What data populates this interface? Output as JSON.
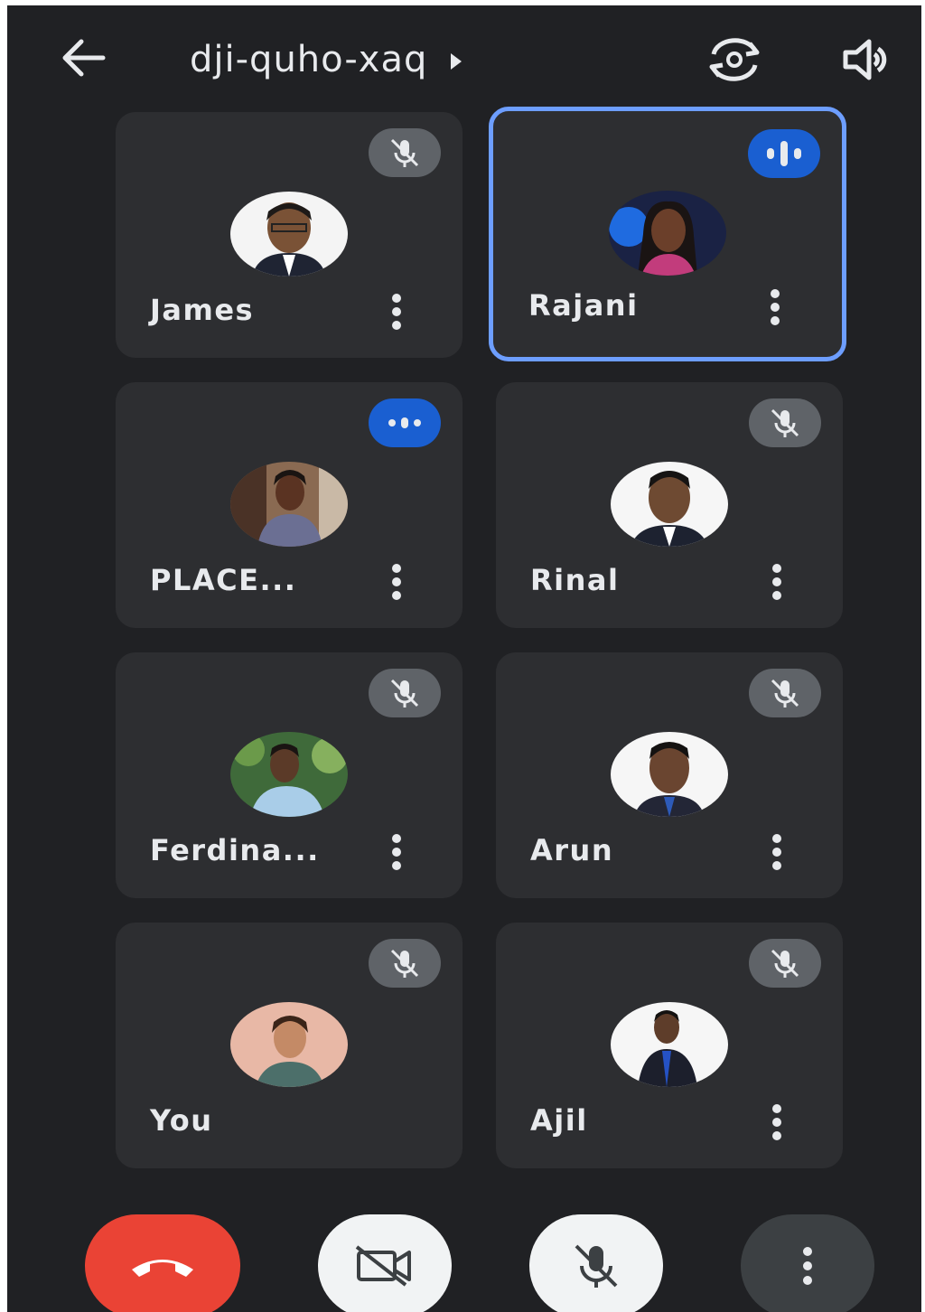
{
  "header": {
    "meeting_code": "dji-quho-xaq",
    "back_icon": "arrow-left-icon",
    "switch_camera_icon": "switch-camera-icon",
    "speaker_icon": "speaker-icon"
  },
  "participants": [
    {
      "name": "James",
      "mic": "muted",
      "active": false,
      "has_menu": true
    },
    {
      "name": "Rajani",
      "mic": "speaking",
      "active": true,
      "has_menu": true
    },
    {
      "name": "PLACE...",
      "mic": "unmuted",
      "active": false,
      "has_menu": true
    },
    {
      "name": "Rinal",
      "mic": "muted",
      "active": false,
      "has_menu": true
    },
    {
      "name": "Ferdina...",
      "mic": "muted",
      "active": false,
      "has_menu": true
    },
    {
      "name": "Arun",
      "mic": "muted",
      "active": false,
      "has_menu": true
    },
    {
      "name": "You",
      "mic": "muted",
      "active": false,
      "has_menu": false
    },
    {
      "name": "Ajil",
      "mic": "muted",
      "active": false,
      "has_menu": true
    }
  ],
  "controls": {
    "end_call_icon": "phone-hangup-icon",
    "camera_icon": "camera-off-icon",
    "mic_icon": "mic-off-icon",
    "more_icon": "more-vertical-icon"
  },
  "colors": {
    "background": "#202124",
    "tile": "#2d2e31",
    "active_border": "#6d9eff",
    "speaking_badge": "#1a5fd1",
    "muted_badge": "#5f6368",
    "end_call": "#ea4335"
  }
}
